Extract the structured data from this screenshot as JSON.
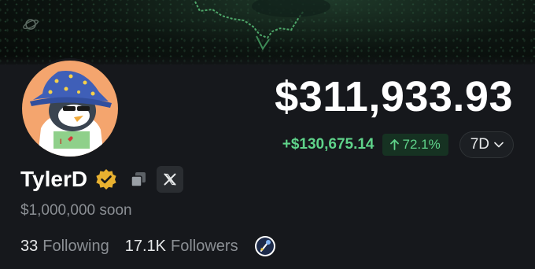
{
  "profile": {
    "name": "TylerD",
    "tagline": "$1,000,000 soon",
    "following_count": "33",
    "following_label": "Following",
    "followers_count": "17.1K",
    "followers_label": "Followers"
  },
  "portfolio": {
    "value": "$311,933.93",
    "change_abs": "+$130,675.14",
    "change_pct": "72.1%",
    "period": "7D"
  },
  "icons": {
    "banner": "planet-icon",
    "verified": "verified-badge-icon",
    "copy": "copy-icon",
    "x": "x-logo-icon",
    "period_dropdown": "chevron-down-icon",
    "change_up": "arrow-up-icon",
    "badge": "nft-badge-icon"
  },
  "colors": {
    "background": "#16181c",
    "positive": "#5fd38a",
    "positive_bg": "#163222",
    "verified": "#e8b130",
    "muted_text": "#8b8f94"
  }
}
